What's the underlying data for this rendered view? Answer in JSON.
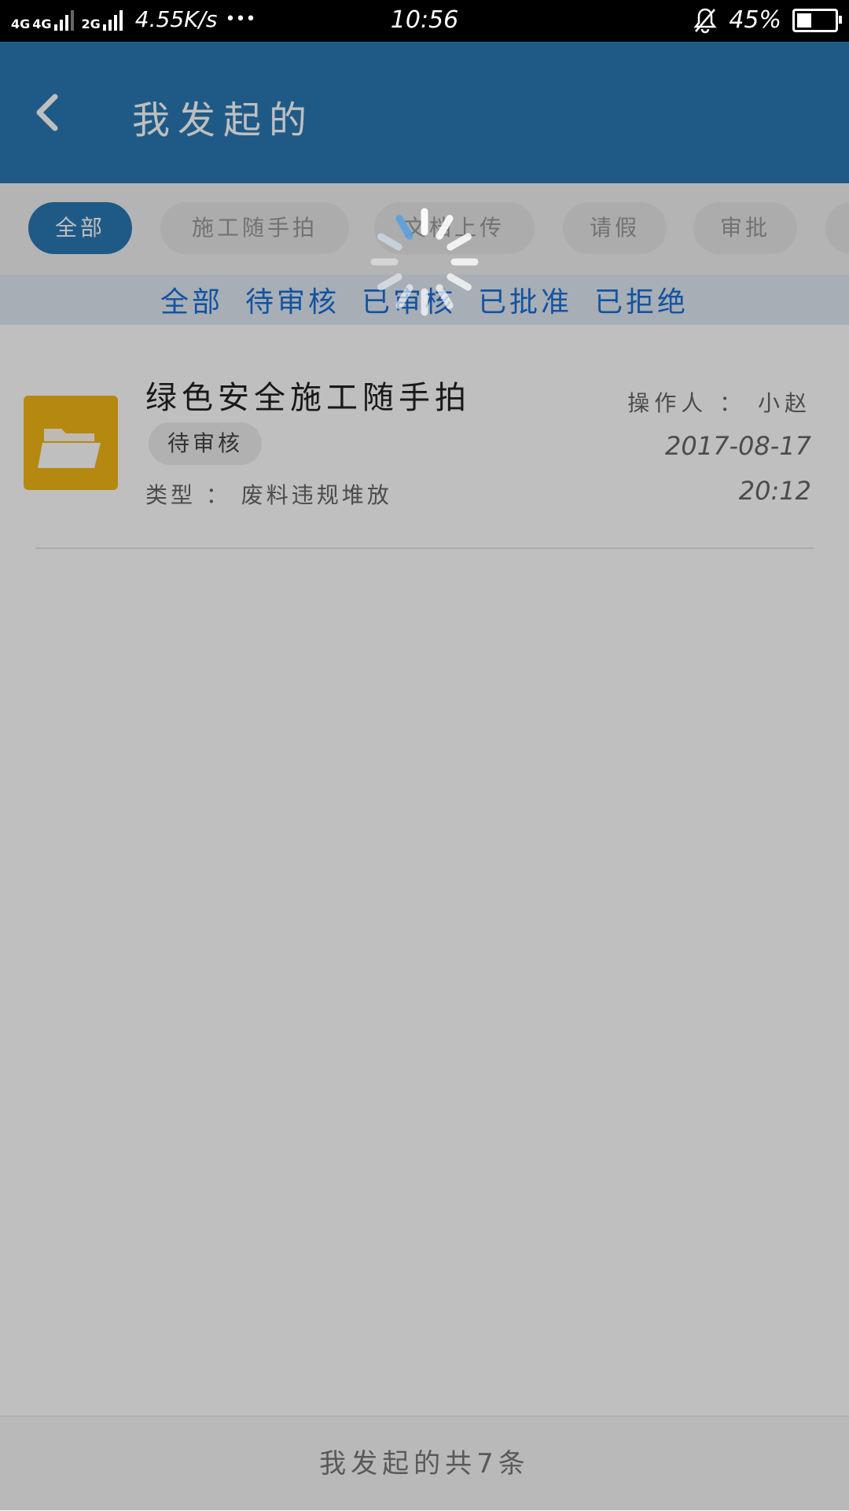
{
  "status_bar": {
    "network_1": "4G",
    "network_2": "4G",
    "network_3": "2G",
    "speed": "4.55K/s",
    "dots": "•••",
    "time": "10:56",
    "battery": "45%",
    "battery_level": 0.45
  },
  "app_bar": {
    "title": "我发起的",
    "back_icon": "chevron-left-icon"
  },
  "categories": [
    {
      "label": "全部",
      "active": true
    },
    {
      "label": "施工随手拍",
      "active": false
    },
    {
      "label": "文档上传",
      "active": false
    },
    {
      "label": "请假",
      "active": false
    },
    {
      "label": "审批",
      "active": false
    }
  ],
  "filters": [
    "全部",
    "待审核",
    "已审核",
    "已批准",
    "已拒绝"
  ],
  "items": [
    {
      "title": "绿色安全施工随手拍",
      "status": "待审核",
      "type": "类型 ： 废料违规堆放",
      "operator": "操作人 ： 小赵",
      "date": "2017-08-17",
      "time": "20:12",
      "icon": "folder-icon"
    }
  ],
  "footer": {
    "text": "我发起的共7条"
  },
  "loading": true,
  "colors": {
    "primary": "#2a78b4",
    "folder": "#f2b616",
    "filter_text": "#1a6fd6"
  }
}
